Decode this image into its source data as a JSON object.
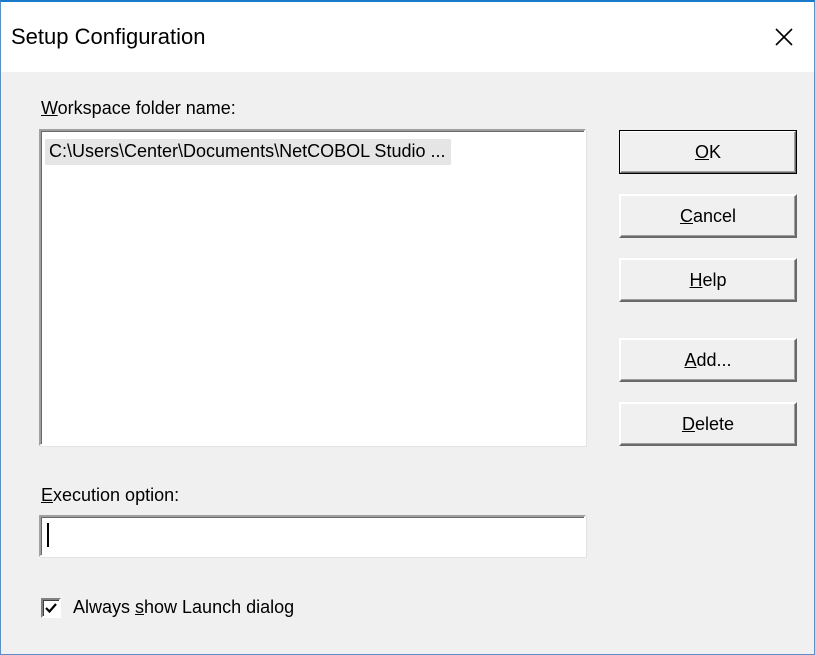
{
  "window": {
    "title": "Setup Configuration",
    "close_glyph": "✕"
  },
  "workspace": {
    "label_accel": "W",
    "label_rest": "orkspace folder name:",
    "items": [
      "C:\\Users\\Center\\Documents\\NetCOBOL Studio ..."
    ]
  },
  "buttons": {
    "ok": {
      "pre": "",
      "accel": "O",
      "post": "K"
    },
    "cancel": {
      "pre": "",
      "accel": "C",
      "post": "ancel"
    },
    "help": {
      "pre": "",
      "accel": "H",
      "post": "elp"
    },
    "add": {
      "pre": "",
      "accel": "A",
      "post": "dd..."
    },
    "delete": {
      "pre": "",
      "accel": "D",
      "post": "elete"
    }
  },
  "execution": {
    "label_accel": "E",
    "label_rest": "xecution option:",
    "value": ""
  },
  "launch_dialog": {
    "checked": true,
    "label_pre": "Always ",
    "label_accel": "s",
    "label_post": "how Launch dialog"
  },
  "colors": {
    "title_border": "#1979ca",
    "dialog_bg": "#f0f0f0",
    "selection_bg": "#e5e5e5"
  },
  "icons": {
    "close": "close-icon",
    "check": "checkmark-icon"
  }
}
